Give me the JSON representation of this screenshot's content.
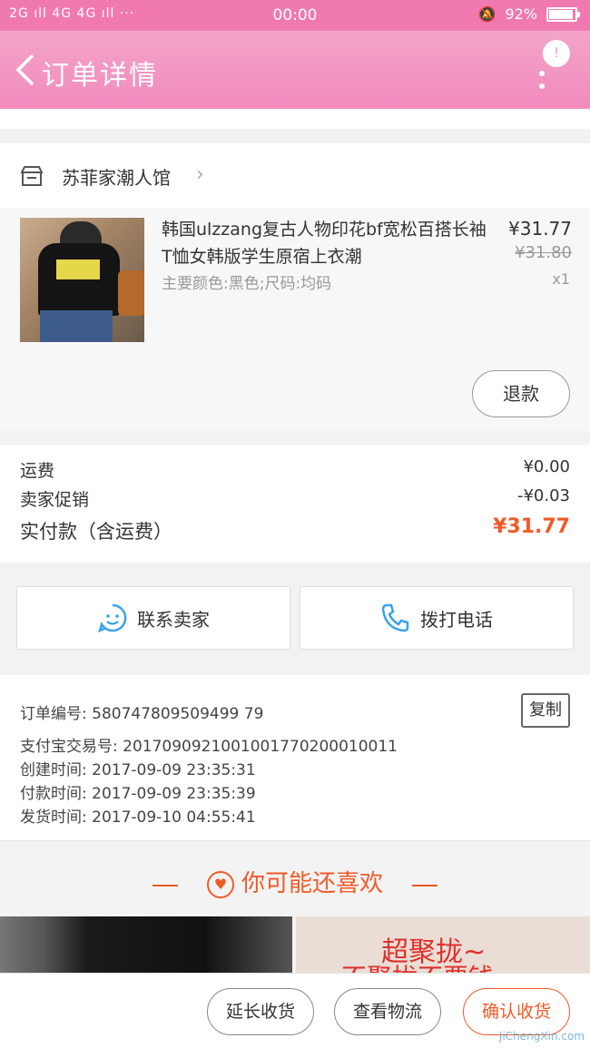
{
  "status_bar": {
    "signal": "2G ıll 4G 4G ıll ···",
    "time": "00:00",
    "battery": "92%",
    "battery_level": 0.92
  },
  "header": {
    "title": "订单详情",
    "more_badge": "!"
  },
  "shop": {
    "name": "苏菲家潮人馆",
    "chevron": "›"
  },
  "product": {
    "title": "韩国ulzzang复古人物印花bf宽松百搭长袖T恤女韩版学生原宿上衣潮",
    "sku": "主要颜色:黑色;尺码:均码",
    "price": "¥31.77",
    "original_price": "¥31.80",
    "quantity": "x1",
    "refund_label": "退款"
  },
  "fees": {
    "shipping_label": "运费",
    "shipping_value": "¥0.00",
    "promo_label": "卖家促销",
    "promo_value": "-¥0.03",
    "total_label": "实付款（含运费）",
    "total_value": "¥31.77"
  },
  "contact": {
    "seller_label": "联系卖家",
    "phone_label": "拨打电话"
  },
  "order_info": {
    "order_no": "订单编号: 580747809509499 79",
    "alipay_no": "支付宝交易号: 2017090921001001770200010011",
    "created": "创建时间: 2017-09-09 23:35:31",
    "paid": "付款时间: 2017-09-09 23:35:39",
    "shipped": "发货时间: 2017-09-10 04:55:41",
    "copy_label": "复制"
  },
  "recommend": {
    "title": "你可能还喜欢",
    "ad_line1": "超聚拢~",
    "ad_line2": "不聚拢不要钱"
  },
  "bottom_bar": {
    "extend_label": "延长收货",
    "logistics_label": "查看物流",
    "confirm_label": "确认收货"
  },
  "watermark": "JiChengXin.com",
  "colors": {
    "header_pink": "#f28bbd",
    "accent_orange": "#f05a28",
    "icon_blue": "#3aa3e8"
  }
}
